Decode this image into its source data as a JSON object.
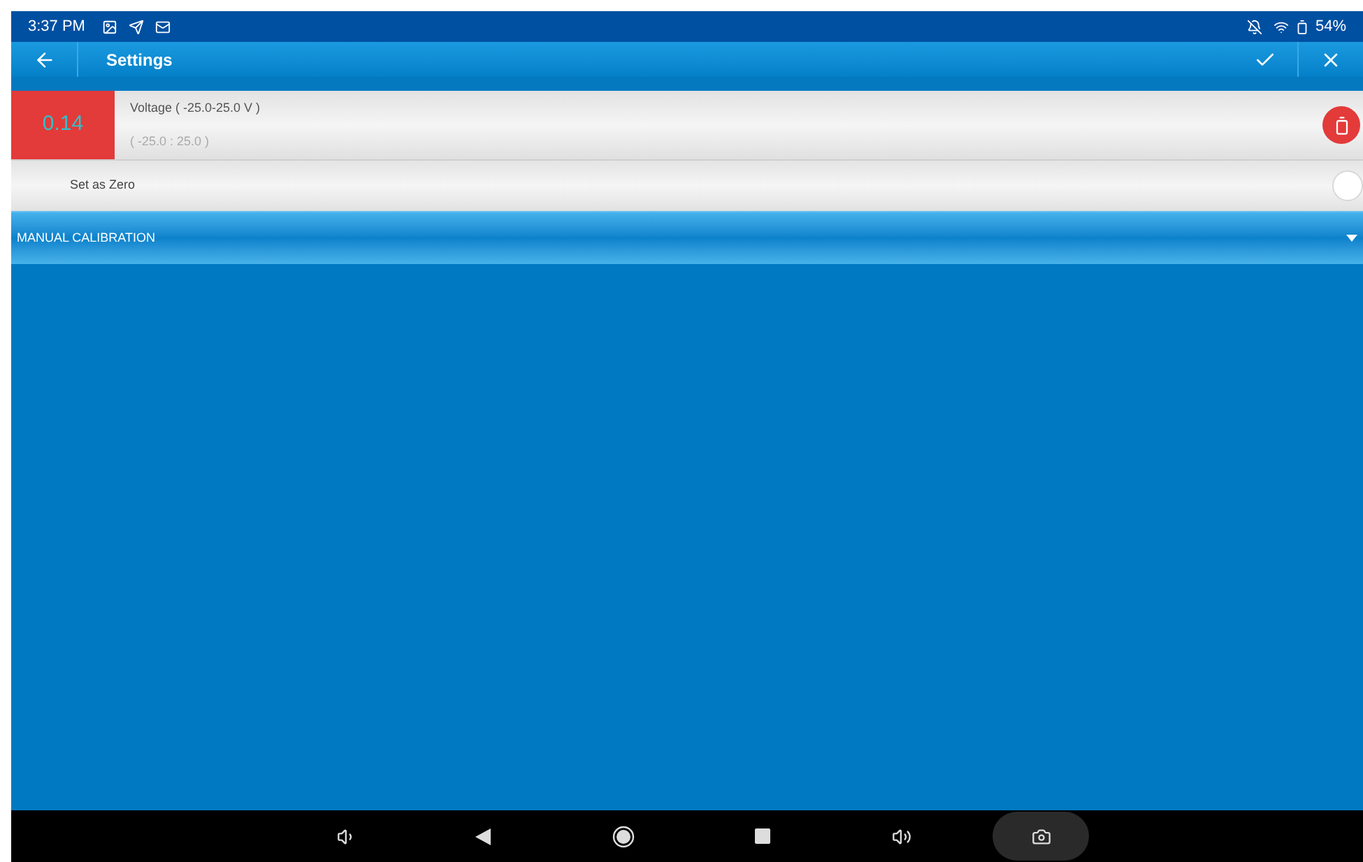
{
  "status_bar": {
    "time": "3:37 PM",
    "battery": "54%"
  },
  "title_bar": {
    "title": "Settings"
  },
  "sensor": {
    "reading": "0.14",
    "name": "Voltage ( -25.0-25.0 V )",
    "range": "( -25.0 : 25.0 )"
  },
  "set_zero": {
    "label": "Set as Zero",
    "on": false
  },
  "section": {
    "title": "MANUAL CALIBRATION",
    "expanded": false
  }
}
